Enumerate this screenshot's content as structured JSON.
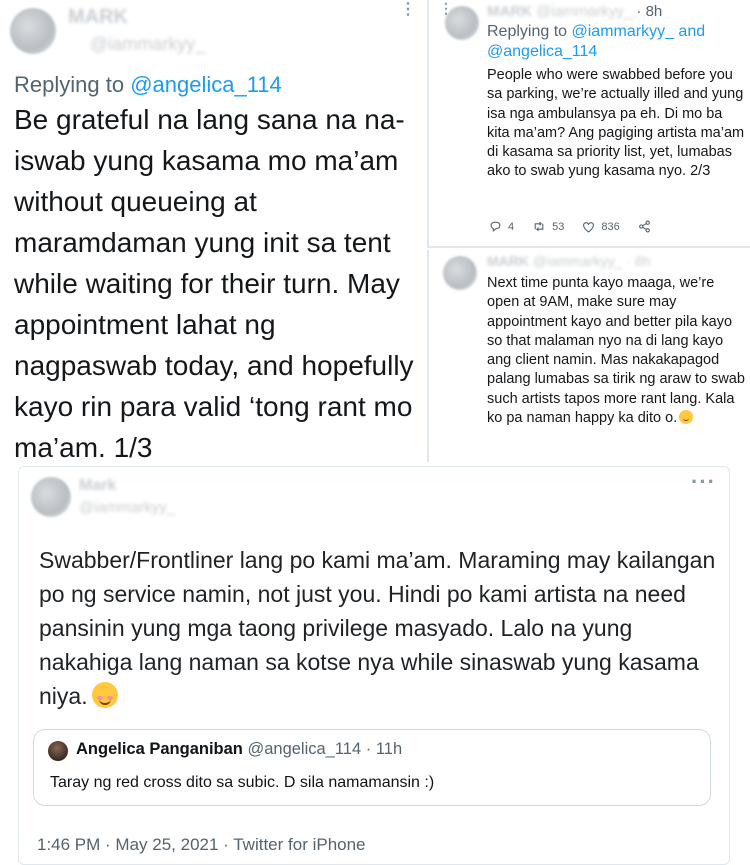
{
  "tweet1": {
    "name": "MARK",
    "handle": "@iammarkyy_",
    "reply_prefix": "Replying to ",
    "reply_to": "@angelica_114",
    "text": "Be grateful na lang sana na na-iswab yung kasama mo ma’am without queueing at maramdaman yung init sa tent while waiting for their turn. May appointment lahat ng nagpaswab today, and hopefully kayo rin para valid ‘tong rant mo ma’am. 1/3"
  },
  "tweet2": {
    "name": "MARK",
    "handle": "@iammarkyy_",
    "time": "· 8h",
    "reply_prefix": "Replying to ",
    "reply_to_1": "@iammarkyy_ and",
    "reply_to_2": "@angelica_114",
    "text": "People who were swabbed before you sa parking, we’re actually illed and yung isa nga ambulansya pa eh. Di mo ba kita ma’am? Ang pagiging artista ma’am di kasama sa priority list, yet, lumabas ako to swab yung kasama nyo. 2/3",
    "stats": {
      "replies": "4",
      "retweets": "53",
      "likes": "836"
    }
  },
  "tweet3": {
    "name": "MARK",
    "handle": "@iammarkyy_",
    "time": "· 8h",
    "text": "Next time punta kayo maaga, we’re open at 9AM, make sure may appointment kayo and better pila kayo so that malaman nyo na di lang kayo ang client namin. Mas nakakapagod palang lumabas sa tirik ng araw to swab such artists tapos more rant lang. Kala ko pa naman happy ka dito o."
  },
  "tweet4": {
    "name": "Mark",
    "handle": "@iammarkyy_",
    "text": "Swabber/Frontliner lang po kami ma’am. Maraming may kailangan po ng service namin, not just you. Hindi po kami artista na need pansinin yung mga taong privilege masyado. Lalo na yung nakahiga lang naman sa kotse nya while sinaswab yung kasama niya.",
    "quote": {
      "name": "Angelica Panganiban",
      "handle": "@angelica_114",
      "time": "· 11h",
      "text": "Taray ng red cross dito sa subic. D sila namamansin :)"
    },
    "footer": "1:46 PM · May 25, 2021 · Twitter for iPhone"
  },
  "icons": {
    "more": "more-dots-icon",
    "reply": "reply-icon",
    "retweet": "retweet-icon",
    "like": "heart-icon",
    "share": "share-icon",
    "emoji": "smiling-face-emoji"
  },
  "colors": {
    "link": "#1d9bf0",
    "secondary": "#536471",
    "border": "#e1e8ed"
  }
}
